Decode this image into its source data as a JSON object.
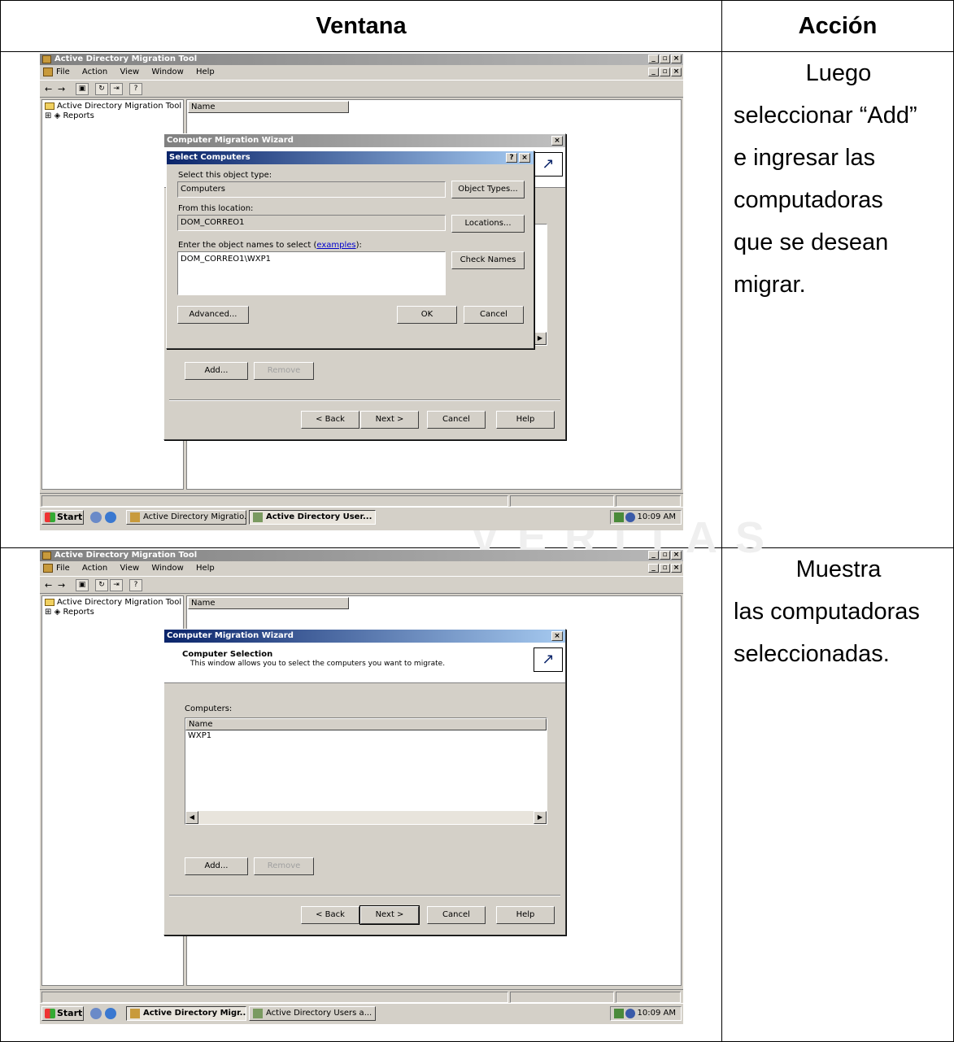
{
  "table": {
    "headers": {
      "window": "Ventana",
      "action": "Acción"
    },
    "rows": [
      {
        "action_lines": [
          "Luego",
          "seleccionar “Add”",
          "e ingresar las",
          "computadoras",
          "que se desean",
          "migrar."
        ]
      },
      {
        "action_lines": [
          "Muestra",
          "las computadoras",
          "seleccionadas."
        ]
      }
    ]
  },
  "app": {
    "title": "Active Directory Migration Tool",
    "menu": [
      "File",
      "Action",
      "View",
      "Window",
      "Help"
    ],
    "tree_root": "Active Directory Migration Tool",
    "tree_child": "Reports",
    "column_name": "Name",
    "start": "Start",
    "clock": "10:09 AM"
  },
  "shot1": {
    "task1": "Active Directory Migratio...",
    "task2": "Active Directory User...",
    "wizard_title": "Computer Migration Wizard",
    "dialog": {
      "title": "Select Computers",
      "help_btn": "?",
      "obj_type_label": "Select this object type:",
      "obj_type_value": "Computers",
      "obj_types_btn": "Object Types...",
      "location_label": "From this location:",
      "location_value": "DOM_CORREO1",
      "locations_btn": "Locations...",
      "names_label": "Enter the object names to select",
      "examples_link": "examples",
      "names_value": "DOM_CORREO1\\WXP1",
      "check_names_btn": "Check Names",
      "advanced_btn": "Advanced...",
      "ok_btn": "OK",
      "cancel_btn": "Cancel"
    },
    "add_btn": "Add...",
    "remove_btn": "Remove",
    "back_btn": "< Back",
    "next_btn": "Next >",
    "cancel_btn": "Cancel",
    "help_btn": "Help"
  },
  "shot2": {
    "task1": "Active Directory Migr...",
    "task2": "Active Directory Users a...",
    "wizard_title": "Computer Migration Wizard",
    "heading": "Computer Selection",
    "subheading": "This window allows you to select the computers you want to migrate.",
    "computers_label": "Computers:",
    "list_header": "Name",
    "list_items": [
      "WXP1"
    ],
    "add_btn": "Add...",
    "remove_btn": "Remove",
    "back_btn": "< Back",
    "next_btn": "Next >",
    "cancel_btn": "Cancel",
    "help_btn": "Help"
  }
}
